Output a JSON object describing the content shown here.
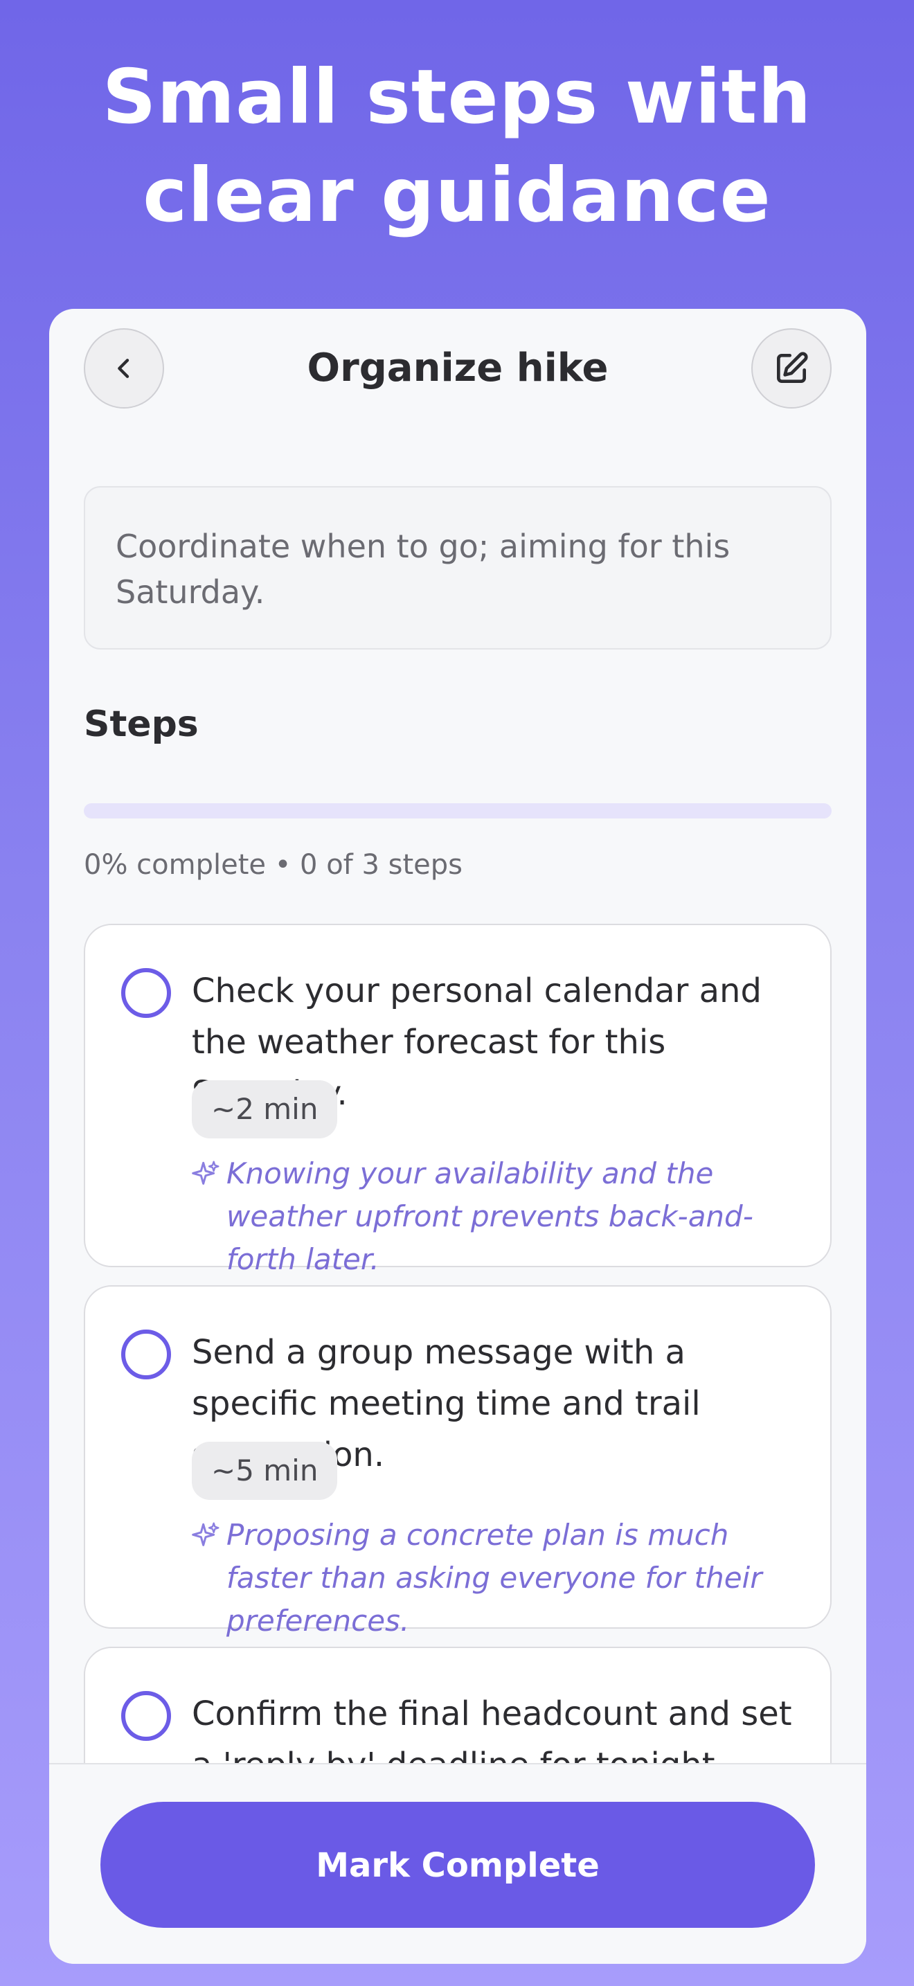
{
  "headline": {
    "line1": "Small steps with",
    "line2": "clear guidance"
  },
  "task": {
    "title": "Organize hike",
    "note": "Coordinate when to go; aiming for this Saturday."
  },
  "steps_section": {
    "title": "Steps",
    "progress_percent": 0,
    "progress_text": "0% complete • 0 of 3 steps",
    "items": [
      {
        "text": "Check your personal calendar and the weather forecast for this Saturday.",
        "time": "~2 min",
        "tip": "Knowing your availability and the weather upfront prevents back-and-forth later.",
        "completed": false
      },
      {
        "text": "Send a group message with a specific meeting time and trail suggestion.",
        "time": "~5 min",
        "tip": "Proposing a concrete plan is much faster than asking everyone for their preferences.",
        "completed": false
      },
      {
        "text": "Confirm the final headcount and set a 'reply by' deadline for tonight.",
        "completed": false
      }
    ]
  },
  "footer": {
    "mark_complete_label": "Mark Complete"
  },
  "icons": {
    "back": "chevron-left-icon",
    "edit": "edit-icon",
    "tip": "sparkle-icon"
  },
  "colors": {
    "accent": "#6a5ae6",
    "tip_text": "#7b6ed6",
    "background_top": "#7066e8",
    "background_bottom": "#a79cfb"
  }
}
